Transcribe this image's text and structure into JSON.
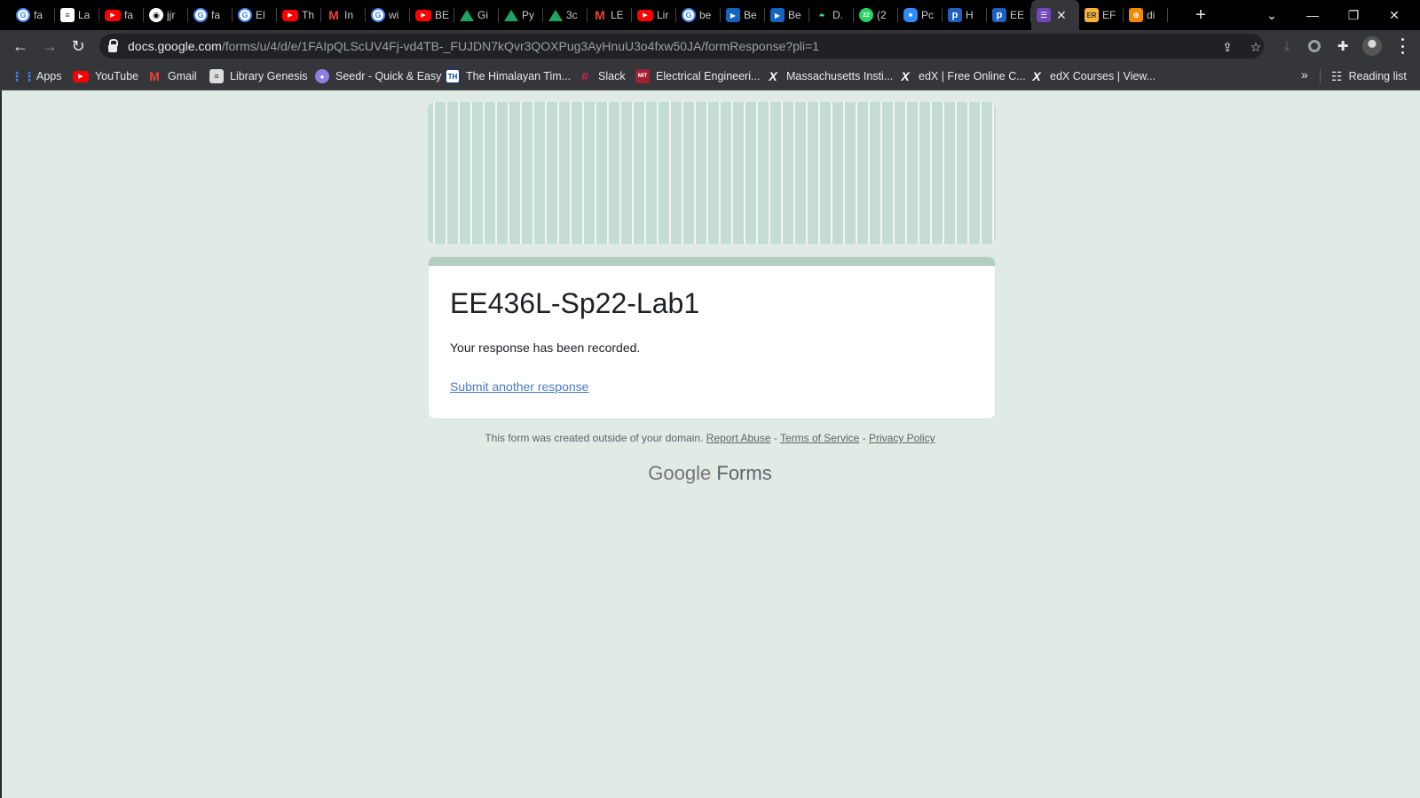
{
  "browser": {
    "tabs": [
      {
        "icon": "google-icon",
        "glyph": "G",
        "cls": "fav-google",
        "title": "fa"
      },
      {
        "icon": "document-icon",
        "glyph": "≡",
        "cls": "fav-doc",
        "title": "La"
      },
      {
        "icon": "youtube-icon",
        "glyph": "▶",
        "cls": "fav-yt",
        "title": "fa"
      },
      {
        "icon": "github-icon",
        "glyph": "◉",
        "cls": "fav-gh",
        "title": "jjr"
      },
      {
        "icon": "google-icon",
        "glyph": "G",
        "cls": "fav-google",
        "title": "fa"
      },
      {
        "icon": "google-icon",
        "glyph": "G",
        "cls": "fav-google",
        "title": "El"
      },
      {
        "icon": "youtube-icon",
        "glyph": "▶",
        "cls": "fav-yt",
        "title": "Th"
      },
      {
        "icon": "gmail-icon",
        "glyph": "M",
        "cls": "fav-gmail",
        "title": "In"
      },
      {
        "icon": "google-icon",
        "glyph": "G",
        "cls": "fav-google",
        "title": "wi"
      },
      {
        "icon": "youtube-icon",
        "glyph": "▶",
        "cls": "fav-yt",
        "title": "BE"
      },
      {
        "icon": "google-drive-icon",
        "glyph": "",
        "cls": "fav-drive",
        "title": "Gi"
      },
      {
        "icon": "google-drive-icon",
        "glyph": "",
        "cls": "fav-drive",
        "title": "Py"
      },
      {
        "icon": "google-drive-icon",
        "glyph": "",
        "cls": "fav-drive",
        "title": "3c"
      },
      {
        "icon": "gmail-icon",
        "glyph": "M",
        "cls": "fav-gmail",
        "title": "LE"
      },
      {
        "icon": "youtube-icon",
        "glyph": "▶",
        "cls": "fav-yt",
        "title": "Lir"
      },
      {
        "icon": "google-icon",
        "glyph": "G",
        "cls": "fav-google",
        "title": "be"
      },
      {
        "icon": "play-icon",
        "glyph": "▶",
        "cls": "fav-play",
        "title": "Be"
      },
      {
        "icon": "play-icon",
        "glyph": "▶",
        "cls": "fav-play",
        "title": "Be"
      },
      {
        "icon": "android-icon",
        "glyph": "◓",
        "cls": "fav-and",
        "title": "D."
      },
      {
        "icon": "whatsapp-icon",
        "glyph": "22",
        "cls": "fav-wa",
        "title": "(2"
      },
      {
        "icon": "zoom-icon",
        "glyph": "■",
        "cls": "fav-zoom",
        "title": "Pc"
      },
      {
        "icon": "p-icon",
        "glyph": "p",
        "cls": "fav-p",
        "title": "H"
      },
      {
        "icon": "p-icon",
        "glyph": "p",
        "cls": "fav-p",
        "title": "EE"
      },
      {
        "icon": "google-forms-icon",
        "glyph": "☰",
        "cls": "fav-forms",
        "title": "",
        "active": true
      },
      {
        "icon": "er-icon",
        "glyph": "ER",
        "cls": "fav-er",
        "title": "EF"
      },
      {
        "icon": "org-chart-icon",
        "glyph": "⊕",
        "cls": "fav-org",
        "title": "di"
      }
    ],
    "url_host": "docs.google.com",
    "url_path": "/forms/u/4/d/e/1FAIpQLScUV4Fj-vd4TB-_FUJDN7kQvr3QOXPug3AyHnuU3o4fxw50JA/formResponse?pli=1",
    "bookmarks": [
      {
        "icon": "apps-grid-icon",
        "glyph": "⋮⋮",
        "cls": "fav-apps",
        "label": "Apps"
      },
      {
        "icon": "youtube-icon",
        "glyph": "▶",
        "cls": "fav-yt",
        "label": "YouTube"
      },
      {
        "icon": "gmail-icon",
        "glyph": "M",
        "cls": "fav-gmail",
        "label": "Gmail"
      },
      {
        "icon": "library-icon",
        "glyph": "≡",
        "cls": "fav-lib",
        "label": "Library Genesis"
      },
      {
        "icon": "seedr-icon",
        "glyph": "●",
        "cls": "fav-seedr",
        "label": "Seedr - Quick & Easy"
      },
      {
        "icon": "himalayan-times-icon",
        "glyph": "TH",
        "cls": "fav-him",
        "label": "The Himalayan Tim..."
      },
      {
        "icon": "slack-icon",
        "glyph": "#",
        "cls": "fav-slack",
        "label": "Slack"
      },
      {
        "icon": "mit-ocw-icon",
        "glyph": "MIT",
        "cls": "fav-mit",
        "label": "Electrical Engineeri..."
      },
      {
        "icon": "edx-icon",
        "glyph": "X",
        "cls": "fav-edx",
        "label": "Massachusetts Insti..."
      },
      {
        "icon": "edx-icon",
        "glyph": "X",
        "cls": "fav-edx",
        "label": "edX | Free Online C..."
      },
      {
        "icon": "edx-icon",
        "glyph": "X",
        "cls": "fav-edx",
        "label": "edX Courses | View..."
      }
    ],
    "reading_list_label": "Reading list"
  },
  "form": {
    "title": "EE436L-Sp22-Lab1",
    "confirmation": "Your response has been recorded.",
    "another_link": "Submit another response"
  },
  "footer": {
    "note": "This form was created outside of your domain.",
    "report_abuse": "Report Abuse",
    "sep": " - ",
    "terms": "Terms of Service",
    "privacy": "Privacy Policy",
    "brand_google": "Google",
    "brand_forms": "Forms"
  },
  "colors": {
    "page_bg": "#e1ebe6",
    "accent": "#b3cdc1",
    "link": "#4d79c7"
  }
}
